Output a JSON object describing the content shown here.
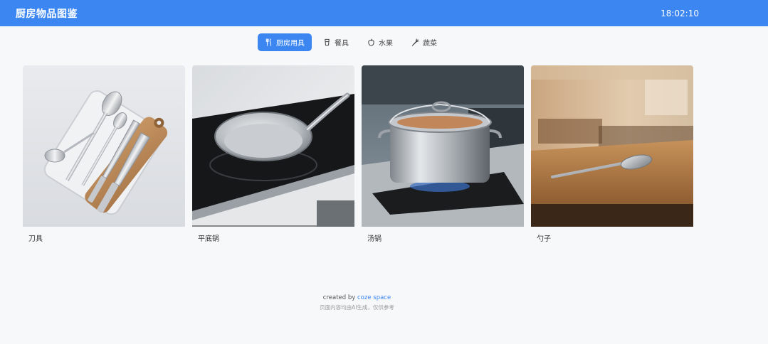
{
  "header": {
    "title": "厨房物品图鉴",
    "time": "18:02:10",
    "color": "#3b86f1"
  },
  "tabs": [
    {
      "label": "厨房用具",
      "icon": "utensils-icon",
      "active": true
    },
    {
      "label": "餐具",
      "icon": "cup-icon",
      "active": false
    },
    {
      "label": "水果",
      "icon": "apple-icon",
      "active": false
    },
    {
      "label": "蔬菜",
      "icon": "carrot-icon",
      "active": false
    }
  ],
  "items": [
    {
      "label": "刀具",
      "image": "knife-set-image"
    },
    {
      "label": "平底锅",
      "image": "frying-pan-image"
    },
    {
      "label": "汤锅",
      "image": "stock-pot-image"
    },
    {
      "label": "勺子",
      "image": "spoon-image"
    }
  ],
  "footer": {
    "created_by": "created by ",
    "brand": "coze space",
    "disclaimer": "页面内容均由AI生成，仅供参考"
  }
}
